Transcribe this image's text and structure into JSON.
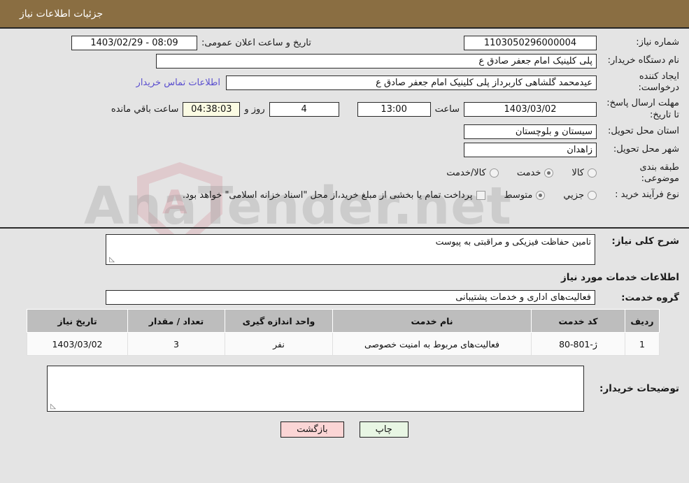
{
  "header": {
    "title": "جزئیات اطلاعات نیاز"
  },
  "form": {
    "need_number_label": "شماره نیاز:",
    "need_number_value": "1103050296000004",
    "announce_label": "تاریخ و ساعت اعلان عمومی:",
    "announce_value": "08:09 - 1403/02/29",
    "buyer_org_label": "نام دستگاه خریدار:",
    "buyer_org_value": "پلی کلینیک امام جعفر صادق ع",
    "creator_label": "ایجاد کننده درخواست:",
    "creator_value": "عیدمحمد گلشاهی کاربرداز پلی کلینیک امام جعفر صادق ع",
    "contact_link": "اطلاعات تماس خریدار",
    "deadline_label": "مهلت ارسال پاسخ: تا تاریخ:",
    "deadline_date": "1403/03/02",
    "hour_label": "ساعت",
    "hour_value": "13:00",
    "days_value": "4",
    "days_label": "روز و",
    "countdown_value": "04:38:03",
    "countdown_label": "ساعت باقي مانده",
    "province_label": "استان محل تحویل:",
    "province_value": "سیستان و بلوچستان",
    "city_label": "شهر محل تحویل:",
    "city_value": "زاهدان",
    "category_label": "طبقه بندی موضوعی:",
    "category_options": [
      {
        "label": "کالا",
        "selected": false
      },
      {
        "label": "خدمت",
        "selected": true
      },
      {
        "label": "کالا/خدمت",
        "selected": false
      }
    ],
    "process_label": "نوع فرآیند خرید :",
    "process_options": [
      {
        "label": "جزیي",
        "selected": false
      },
      {
        "label": "متوسط",
        "selected": true
      }
    ],
    "treasury_checkbox_note": "پرداخت تمام یا بخشی از مبلغ خرید،از محل \"اسناد خزانه اسلامی\" خواهد بود.",
    "treasury_checked": false
  },
  "description": {
    "label": "شرح کلی نیاز:",
    "value": "تامین حفاظت فیزیکی و مراقبتی به پیوست"
  },
  "services_section": {
    "heading": "اطلاعات خدمات مورد نیاز",
    "group_label": "گروه خدمت:",
    "group_value": "فعالیت‌های اداری و خدمات پشتیبانی"
  },
  "table": {
    "columns": [
      "ردیف",
      "کد خدمت",
      "نام خدمت",
      "واحد اندازه گیری",
      "تعداد / مقدار",
      "تاریخ نیاز"
    ],
    "rows": [
      {
        "row_no": "1",
        "service_code": "ژ-801-80",
        "service_name": "فعالیت‌های مربوط به امنیت خصوصی",
        "unit": "نفر",
        "quantity": "3",
        "need_date": "1403/03/02"
      }
    ]
  },
  "buyer_notes": {
    "label": "توضیحات خریدار:",
    "value": ""
  },
  "buttons": {
    "print": "چاپ",
    "back": "بازگشت"
  },
  "watermark": {
    "text": "AnaTender.net",
    "mark": "A"
  },
  "colors": {
    "header_bg": "#8a6e42",
    "link": "#5b4fcf",
    "print_btn": "#e8f6e4",
    "back_btn": "#fbd5d5",
    "countdown_bg": "#fbfbe3",
    "table_header_bg": "#bdbdbd"
  }
}
